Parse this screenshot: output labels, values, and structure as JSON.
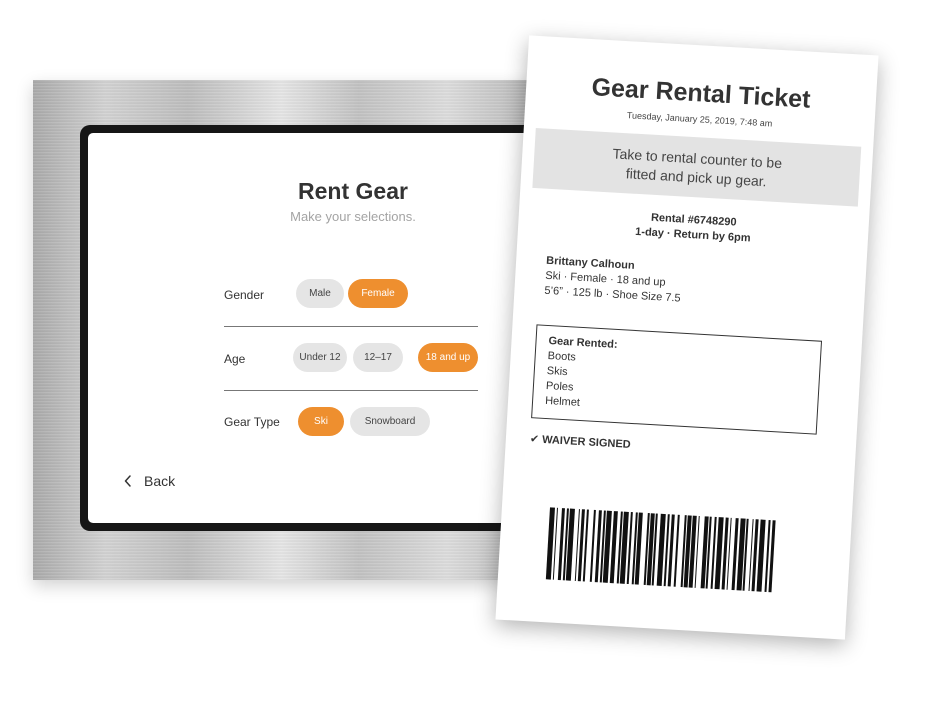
{
  "kiosk": {
    "title": "Rent Gear",
    "subtitle": "Make your selections.",
    "rows": [
      {
        "label": "Gender",
        "options": [
          {
            "label": "Male",
            "selected": false
          },
          {
            "label": "Female",
            "selected": true
          }
        ]
      },
      {
        "label": "Age",
        "options": [
          {
            "label": "Under 12",
            "selected": false
          },
          {
            "label": "12–17",
            "selected": false
          },
          {
            "label": "18 and up",
            "selected": true
          }
        ]
      },
      {
        "label": "Gear Type",
        "options": [
          {
            "label": "Ski",
            "selected": true
          },
          {
            "label": "Snowboard",
            "selected": false
          }
        ]
      }
    ],
    "back_label": "Back",
    "accent_color": "#EE8F2F"
  },
  "ticket": {
    "title": "Gear Rental Ticket",
    "date": "Tuesday, January 25, 2019, 7:48 am",
    "banner_line1": "Take to rental counter to be",
    "banner_line2": "fitted and pick up gear.",
    "rental_number": "Rental #6748290",
    "rental_terms": "1-day · Return by 6pm",
    "customer": {
      "name": "Brittany Calhoun",
      "line1": "Ski · Female · 18 and up",
      "line2": "5’6” · 125 lb · Shoe Size 7.5"
    },
    "gear_heading": "Gear Rented:",
    "gear_items": [
      "Boots",
      "Skis",
      "Poles",
      "Helmet"
    ],
    "waiver_check": "✔",
    "waiver_text": "WAIVER SIGNED"
  }
}
